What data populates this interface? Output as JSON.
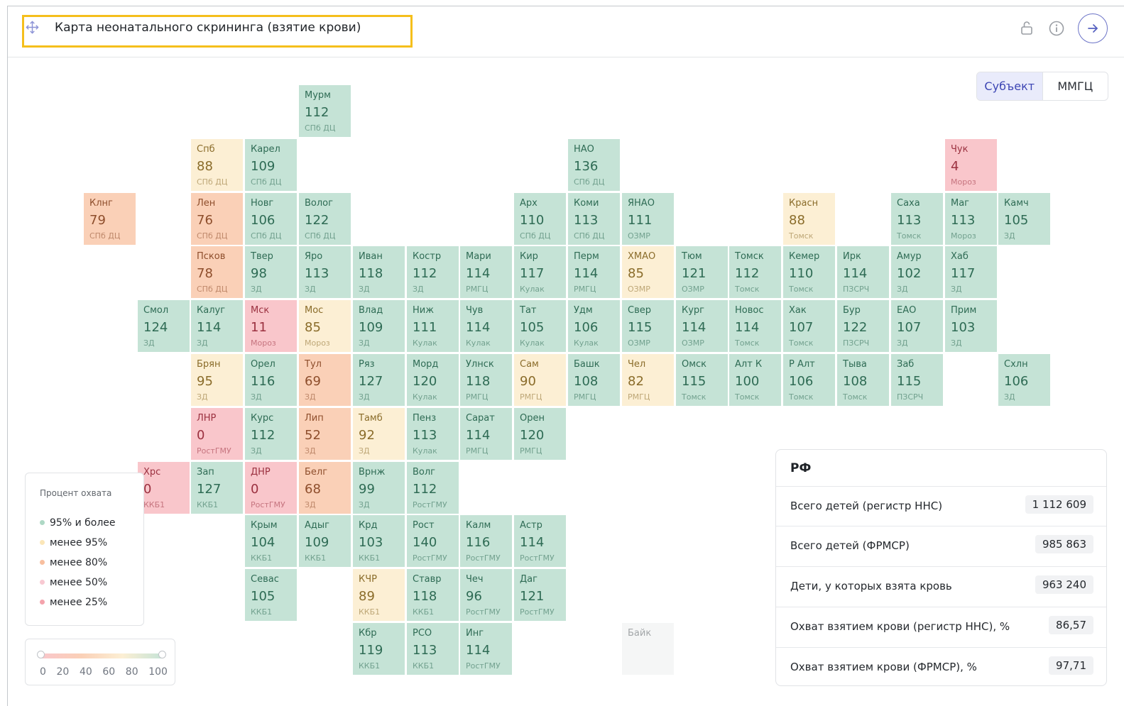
{
  "header": {
    "title": "Карта неонатального скрининга (взятие крови)"
  },
  "toggle": {
    "options": [
      "Субъект",
      "ММГЦ"
    ],
    "selected": "Субъект"
  },
  "colors": {
    "accent": "#3d46b4",
    "title_highlight": "#f5bf1c",
    "ge95": "#c5e3d6",
    "lt95": "#fcefd4",
    "lt80": "#fad0b7",
    "lt50": "#f9c6cb",
    "lt25": "#f9c6cb",
    "no_data": "#f5f6f6"
  },
  "map": {
    "cells": [
      {
        "r": 0,
        "c": 5,
        "name": "Мурм",
        "value": "112",
        "center": "СПб ДЦ",
        "level": "green"
      },
      {
        "r": 1,
        "c": 3,
        "name": "Спб",
        "value": "88",
        "center": "СПб ДЦ",
        "level": "yellow"
      },
      {
        "r": 1,
        "c": 4,
        "name": "Карел",
        "value": "109",
        "center": "СПб ДЦ",
        "level": "green"
      },
      {
        "r": 1,
        "c": 10,
        "name": "НАО",
        "value": "136",
        "center": "СПб ДЦ",
        "level": "green"
      },
      {
        "r": 1,
        "c": 17,
        "name": "Чук",
        "value": "4",
        "center": "Мороз",
        "level": "red"
      },
      {
        "r": 2,
        "c": 1,
        "name": "Клнг",
        "value": "79",
        "center": "СПб ДЦ",
        "level": "orange"
      },
      {
        "r": 2,
        "c": 3,
        "name": "Лен",
        "value": "76",
        "center": "СПб ДЦ",
        "level": "orange"
      },
      {
        "r": 2,
        "c": 4,
        "name": "Новг",
        "value": "106",
        "center": "СПб ДЦ",
        "level": "green"
      },
      {
        "r": 2,
        "c": 5,
        "name": "Волог",
        "value": "122",
        "center": "СПб ДЦ",
        "level": "green"
      },
      {
        "r": 2,
        "c": 9,
        "name": "Арх",
        "value": "110",
        "center": "СПб ДЦ",
        "level": "green"
      },
      {
        "r": 2,
        "c": 10,
        "name": "Коми",
        "value": "113",
        "center": "СПб ДЦ",
        "level": "green"
      },
      {
        "r": 2,
        "c": 11,
        "name": "ЯНАО",
        "value": "111",
        "center": "ОЗМР",
        "level": "green"
      },
      {
        "r": 2,
        "c": 14,
        "name": "Красн",
        "value": "88",
        "center": "Томск",
        "level": "yellow"
      },
      {
        "r": 2,
        "c": 16,
        "name": "Саха",
        "value": "113",
        "center": "Томск",
        "level": "green"
      },
      {
        "r": 2,
        "c": 17,
        "name": "Маг",
        "value": "113",
        "center": "Мороз",
        "level": "green"
      },
      {
        "r": 2,
        "c": 18,
        "name": "Камч",
        "value": "105",
        "center": "ЗД",
        "level": "green"
      },
      {
        "r": 3,
        "c": 3,
        "name": "Псков",
        "value": "78",
        "center": "СПб ДЦ",
        "level": "orange"
      },
      {
        "r": 3,
        "c": 4,
        "name": "Твер",
        "value": "98",
        "center": "ЗД",
        "level": "green"
      },
      {
        "r": 3,
        "c": 5,
        "name": "Яро",
        "value": "113",
        "center": "ЗД",
        "level": "green"
      },
      {
        "r": 3,
        "c": 6,
        "name": "Иван",
        "value": "118",
        "center": "ЗД",
        "level": "green"
      },
      {
        "r": 3,
        "c": 7,
        "name": "Костр",
        "value": "112",
        "center": "ЗД",
        "level": "green"
      },
      {
        "r": 3,
        "c": 8,
        "name": "Мари",
        "value": "114",
        "center": "РМГЦ",
        "level": "green"
      },
      {
        "r": 3,
        "c": 9,
        "name": "Кир",
        "value": "117",
        "center": "Кулак",
        "level": "green"
      },
      {
        "r": 3,
        "c": 10,
        "name": "Перм",
        "value": "114",
        "center": "РМГЦ",
        "level": "green"
      },
      {
        "r": 3,
        "c": 11,
        "name": "ХМАО",
        "value": "85",
        "center": "ОЗМР",
        "level": "yellow"
      },
      {
        "r": 3,
        "c": 12,
        "name": "Тюм",
        "value": "121",
        "center": "ОЗМР",
        "level": "green"
      },
      {
        "r": 3,
        "c": 13,
        "name": "Томск",
        "value": "112",
        "center": "Томск",
        "level": "green"
      },
      {
        "r": 3,
        "c": 14,
        "name": "Кемер",
        "value": "110",
        "center": "Томск",
        "level": "green"
      },
      {
        "r": 3,
        "c": 15,
        "name": "Ирк",
        "value": "114",
        "center": "ПЗСРЧ",
        "level": "green"
      },
      {
        "r": 3,
        "c": 16,
        "name": "Амур",
        "value": "102",
        "center": "ЗД",
        "level": "green"
      },
      {
        "r": 3,
        "c": 17,
        "name": "Хаб",
        "value": "117",
        "center": "ЗД",
        "level": "green"
      },
      {
        "r": 4,
        "c": 2,
        "name": "Смол",
        "value": "124",
        "center": "ЗД",
        "level": "green"
      },
      {
        "r": 4,
        "c": 3,
        "name": "Калуг",
        "value": "114",
        "center": "ЗД",
        "level": "green"
      },
      {
        "r": 4,
        "c": 4,
        "name": "Мск",
        "value": "11",
        "center": "Мороз",
        "level": "red"
      },
      {
        "r": 4,
        "c": 5,
        "name": "Мос",
        "value": "85",
        "center": "Мороз",
        "level": "yellow"
      },
      {
        "r": 4,
        "c": 6,
        "name": "Влад",
        "value": "109",
        "center": "ЗД",
        "level": "green"
      },
      {
        "r": 4,
        "c": 7,
        "name": "Ниж",
        "value": "111",
        "center": "Кулак",
        "level": "green"
      },
      {
        "r": 4,
        "c": 8,
        "name": "Чув",
        "value": "114",
        "center": "Кулак",
        "level": "green"
      },
      {
        "r": 4,
        "c": 9,
        "name": "Тат",
        "value": "105",
        "center": "Кулак",
        "level": "green"
      },
      {
        "r": 4,
        "c": 10,
        "name": "Удм",
        "value": "106",
        "center": "Кулак",
        "level": "green"
      },
      {
        "r": 4,
        "c": 11,
        "name": "Свер",
        "value": "115",
        "center": "ОЗМР",
        "level": "green"
      },
      {
        "r": 4,
        "c": 12,
        "name": "Кург",
        "value": "114",
        "center": "ОЗМР",
        "level": "green"
      },
      {
        "r": 4,
        "c": 13,
        "name": "Новос",
        "value": "114",
        "center": "Томск",
        "level": "green"
      },
      {
        "r": 4,
        "c": 14,
        "name": "Хак",
        "value": "107",
        "center": "Томск",
        "level": "green"
      },
      {
        "r": 4,
        "c": 15,
        "name": "Бур",
        "value": "122",
        "center": "ПЗСРЧ",
        "level": "green"
      },
      {
        "r": 4,
        "c": 16,
        "name": "ЕАО",
        "value": "107",
        "center": "ЗД",
        "level": "green"
      },
      {
        "r": 4,
        "c": 17,
        "name": "Прим",
        "value": "103",
        "center": "ЗД",
        "level": "green"
      },
      {
        "r": 5,
        "c": 3,
        "name": "Брян",
        "value": "95",
        "center": "ЗД",
        "level": "yellow"
      },
      {
        "r": 5,
        "c": 4,
        "name": "Орел",
        "value": "116",
        "center": "ЗД",
        "level": "green"
      },
      {
        "r": 5,
        "c": 5,
        "name": "Тул",
        "value": "69",
        "center": "ЗД",
        "level": "orange"
      },
      {
        "r": 5,
        "c": 6,
        "name": "Ряз",
        "value": "127",
        "center": "ЗД",
        "level": "green"
      },
      {
        "r": 5,
        "c": 7,
        "name": "Морд",
        "value": "120",
        "center": "Кулак",
        "level": "green"
      },
      {
        "r": 5,
        "c": 8,
        "name": "Улнск",
        "value": "118",
        "center": "РМГЦ",
        "level": "green"
      },
      {
        "r": 5,
        "c": 9,
        "name": "Сам",
        "value": "90",
        "center": "РМГЦ",
        "level": "yellow"
      },
      {
        "r": 5,
        "c": 10,
        "name": "Башк",
        "value": "108",
        "center": "РМГЦ",
        "level": "green"
      },
      {
        "r": 5,
        "c": 11,
        "name": "Чел",
        "value": "82",
        "center": "РМГЦ",
        "level": "yellow"
      },
      {
        "r": 5,
        "c": 12,
        "name": "Омск",
        "value": "115",
        "center": "Томск",
        "level": "green"
      },
      {
        "r": 5,
        "c": 13,
        "name": "Алт К",
        "value": "100",
        "center": "Томск",
        "level": "green"
      },
      {
        "r": 5,
        "c": 14,
        "name": "Р Алт",
        "value": "106",
        "center": "Томск",
        "level": "green"
      },
      {
        "r": 5,
        "c": 15,
        "name": "Тыва",
        "value": "108",
        "center": "Томск",
        "level": "green"
      },
      {
        "r": 5,
        "c": 16,
        "name": "Заб",
        "value": "115",
        "center": "ПЗСРЧ",
        "level": "green"
      },
      {
        "r": 5,
        "c": 18,
        "name": "Схлн",
        "value": "106",
        "center": "ЗД",
        "level": "green"
      },
      {
        "r": 6,
        "c": 3,
        "name": "ЛНР",
        "value": "0",
        "center": "РостГМУ",
        "level": "red"
      },
      {
        "r": 6,
        "c": 4,
        "name": "Курс",
        "value": "112",
        "center": "ЗД",
        "level": "green"
      },
      {
        "r": 6,
        "c": 5,
        "name": "Лип",
        "value": "52",
        "center": "ЗД",
        "level": "orange"
      },
      {
        "r": 6,
        "c": 6,
        "name": "Тамб",
        "value": "92",
        "center": "ЗД",
        "level": "yellow"
      },
      {
        "r": 6,
        "c": 7,
        "name": "Пенз",
        "value": "113",
        "center": "Кулак",
        "level": "green"
      },
      {
        "r": 6,
        "c": 8,
        "name": "Сарат",
        "value": "114",
        "center": "РМГЦ",
        "level": "green"
      },
      {
        "r": 6,
        "c": 9,
        "name": "Орен",
        "value": "120",
        "center": "РМГЦ",
        "level": "green"
      },
      {
        "r": 7,
        "c": 2,
        "name": "Хрс",
        "value": "0",
        "center": "ККБ1",
        "level": "red"
      },
      {
        "r": 7,
        "c": 3,
        "name": "Зап",
        "value": "127",
        "center": "ККБ1",
        "level": "green"
      },
      {
        "r": 7,
        "c": 4,
        "name": "ДНР",
        "value": "0",
        "center": "РостГМУ",
        "level": "red"
      },
      {
        "r": 7,
        "c": 5,
        "name": "Белг",
        "value": "68",
        "center": "ЗД",
        "level": "orange"
      },
      {
        "r": 7,
        "c": 6,
        "name": "Врнж",
        "value": "99",
        "center": "ЗД",
        "level": "green"
      },
      {
        "r": 7,
        "c": 7,
        "name": "Волг",
        "value": "112",
        "center": "РостГМУ",
        "level": "green"
      },
      {
        "r": 8,
        "c": 4,
        "name": "Крым",
        "value": "104",
        "center": "ККБ1",
        "level": "green"
      },
      {
        "r": 8,
        "c": 5,
        "name": "Адыг",
        "value": "109",
        "center": "ККБ1",
        "level": "green"
      },
      {
        "r": 8,
        "c": 6,
        "name": "Крд",
        "value": "103",
        "center": "ККБ1",
        "level": "green"
      },
      {
        "r": 8,
        "c": 7,
        "name": "Рост",
        "value": "140",
        "center": "РостГМУ",
        "level": "green"
      },
      {
        "r": 8,
        "c": 8,
        "name": "Калм",
        "value": "116",
        "center": "РостГМУ",
        "level": "green"
      },
      {
        "r": 8,
        "c": 9,
        "name": "Астр",
        "value": "114",
        "center": "РостГМУ",
        "level": "green"
      },
      {
        "r": 9,
        "c": 4,
        "name": "Севас",
        "value": "105",
        "center": "ККБ1",
        "level": "green"
      },
      {
        "r": 9,
        "c": 6,
        "name": "КЧР",
        "value": "89",
        "center": "ККБ1",
        "level": "yellow"
      },
      {
        "r": 9,
        "c": 7,
        "name": "Ставр",
        "value": "118",
        "center": "ККБ1",
        "level": "green"
      },
      {
        "r": 9,
        "c": 8,
        "name": "Чеч",
        "value": "96",
        "center": "РостГМУ",
        "level": "green"
      },
      {
        "r": 9,
        "c": 9,
        "name": "Даг",
        "value": "121",
        "center": "РостГМУ",
        "level": "green"
      },
      {
        "r": 10,
        "c": 6,
        "name": "Кбр",
        "value": "119",
        "center": "ККБ1",
        "level": "green"
      },
      {
        "r": 10,
        "c": 7,
        "name": "РСО",
        "value": "113",
        "center": "ККБ1",
        "level": "green"
      },
      {
        "r": 10,
        "c": 8,
        "name": "Инг",
        "value": "114",
        "center": "РостГМУ",
        "level": "green"
      },
      {
        "r": 10,
        "c": 11,
        "name": "Байк",
        "value": "",
        "center": "",
        "level": "empty"
      }
    ]
  },
  "legend": {
    "title": "Процент охвата",
    "items": [
      {
        "label": "95% и более",
        "color": "#aed8c5"
      },
      {
        "label": "менее 95%",
        "color": "#fbe6b8"
      },
      {
        "label": "менее 80%",
        "color": "#f8bf9f"
      },
      {
        "label": "менее 50%",
        "color": "#f8c9d2"
      },
      {
        "label": "менее 25%",
        "color": "#f4a3ac"
      }
    ]
  },
  "scale": {
    "ticks": [
      "0",
      "20",
      "40",
      "60",
      "80",
      "100"
    ]
  },
  "rf_panel": {
    "title": "РФ",
    "rows": [
      {
        "label": "Всего детей (регистр ННС)",
        "value": "1 112 609"
      },
      {
        "label": "Всего детей (ФРМСР)",
        "value": "985 863"
      },
      {
        "label": "Дети, у которых взята кровь",
        "value": "963 240"
      },
      {
        "label": "Охват взятием крови (регистр ННС), %",
        "value": "86,57"
      },
      {
        "label": "Охват взятием крови (ФРМСР), %",
        "value": "97,71"
      }
    ]
  }
}
